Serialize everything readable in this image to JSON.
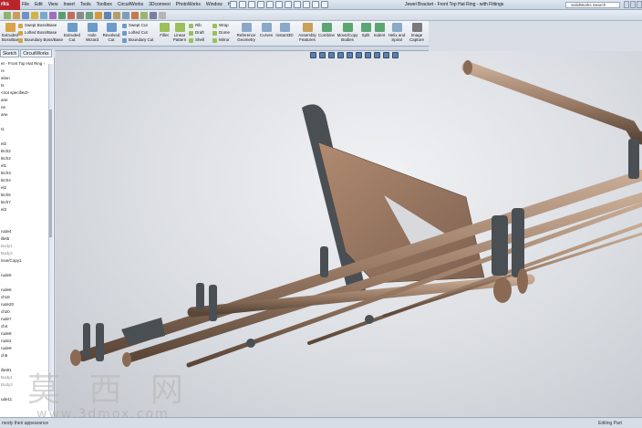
{
  "app": {
    "logo": "rks",
    "doc_title": "Jewel Bracket - Front Top Hat Ring - with Fittings",
    "search_placeholder": "SolidWorks Search"
  },
  "menu": [
    "File",
    "Edit",
    "View",
    "Insert",
    "Tools",
    "Toolbox",
    "CircuitWorks",
    "3Dconnexi",
    "PhotoWorks",
    "Window",
    "Help"
  ],
  "ribbon": {
    "stacked_left": [
      "Swept Boss/Base",
      "Lofted Boss/Base",
      "Boundary Boss/Base"
    ],
    "extruded_left": "Extruded\nBoss/Base",
    "revolved_left": "Revolved\nBoss/Base",
    "extruded_cut": "Extruded\nCut",
    "hole_wizard": "Hole\nWizard",
    "revolved_cut": "Revolved\nCut",
    "cut_stack": [
      "Swept Cut",
      "Lofted Cut",
      "Boundary Cut"
    ],
    "fillet": "Fillet",
    "linear_pattern": "Linear\nPattern",
    "mid_stack": [
      "Rib",
      "Draft",
      "Shell"
    ],
    "mid_stack2": [
      "Wrap",
      "Dome",
      "Mirror"
    ],
    "ref_geometry": "Reference\nGeometry",
    "curves": "Curves",
    "instant3d": "Instant3D",
    "assembly_features": "Assembly\nFeatures",
    "combine": "Combine",
    "move_copy": "Move/Copy\nBodies",
    "split": "Split",
    "indent": "Indent",
    "helix": "Helix and\nSpiral",
    "image_capture": "Image\nCapture"
  },
  "fm_tabs": [
    "Sketch",
    "CircuitWorks"
  ],
  "feature_tree": [
    {
      "label": "et - Front Top Hat Ring -",
      "grey": false
    },
    {
      "label": "rs",
      "grey": false
    },
    {
      "label": "ation",
      "grey": false
    },
    {
      "label": "ts",
      "grey": false
    },
    {
      "label": "<not specified>",
      "grey": false
    },
    {
      "label": "ane",
      "grey": false
    },
    {
      "label": "ne",
      "grey": false
    },
    {
      "label": "ane",
      "grey": false
    },
    {
      "label": "",
      "grey": false
    },
    {
      "label": "t1",
      "grey": false
    },
    {
      "label": "",
      "grey": false
    },
    {
      "label": "el2",
      "grey": false
    },
    {
      "label": "ktch2",
      "grey": false
    },
    {
      "label": "ktch2",
      "grey": false
    },
    {
      "label": "el1",
      "grey": false
    },
    {
      "label": "ktch3",
      "grey": false
    },
    {
      "label": "ktch4",
      "grey": false
    },
    {
      "label": "el2",
      "grey": false
    },
    {
      "label": "ktch6",
      "grey": false
    },
    {
      "label": "ktch7",
      "grey": false
    },
    {
      "label": "el3",
      "grey": false
    },
    {
      "label": "",
      "grey": false
    },
    {
      "label": "",
      "grey": false
    },
    {
      "label": "rude4",
      "grey": false
    },
    {
      "label": "illet5",
      "grey": false
    },
    {
      "label": "Body1",
      "grey": true
    },
    {
      "label": "Body2",
      "grey": true
    },
    {
      "label": "love/Copy1",
      "grey": false
    },
    {
      "label": "",
      "grey": false
    },
    {
      "label": "rude5",
      "grey": false
    },
    {
      "label": "",
      "grey": false
    },
    {
      "label": "rude6",
      "grey": false
    },
    {
      "label": "ch16",
      "grey": false
    },
    {
      "label": "rude20",
      "grey": false
    },
    {
      "label": "ch20",
      "grey": false
    },
    {
      "label": "rude7",
      "grey": false
    },
    {
      "label": "ch4",
      "grey": false
    },
    {
      "label": "rude8",
      "grey": false
    },
    {
      "label": "rude2",
      "grey": false
    },
    {
      "label": "rude9",
      "grey": false
    },
    {
      "label": "ch5",
      "grey": false
    },
    {
      "label": "",
      "grey": false
    },
    {
      "label": "illet01",
      "grey": false
    },
    {
      "label": "Body1",
      "grey": true
    },
    {
      "label": "Body2",
      "grey": true
    },
    {
      "label": "",
      "grey": false
    },
    {
      "label": "ude11",
      "grey": false
    }
  ],
  "status": {
    "left": "mody their appearance",
    "right": "Editing Part"
  },
  "watermark": {
    "text": "莫 西 网",
    "url": "www.3dmox.com"
  },
  "colors": {
    "accent": "#b8242a",
    "bronze": "#8a6a55",
    "steel": "#4f5559"
  }
}
